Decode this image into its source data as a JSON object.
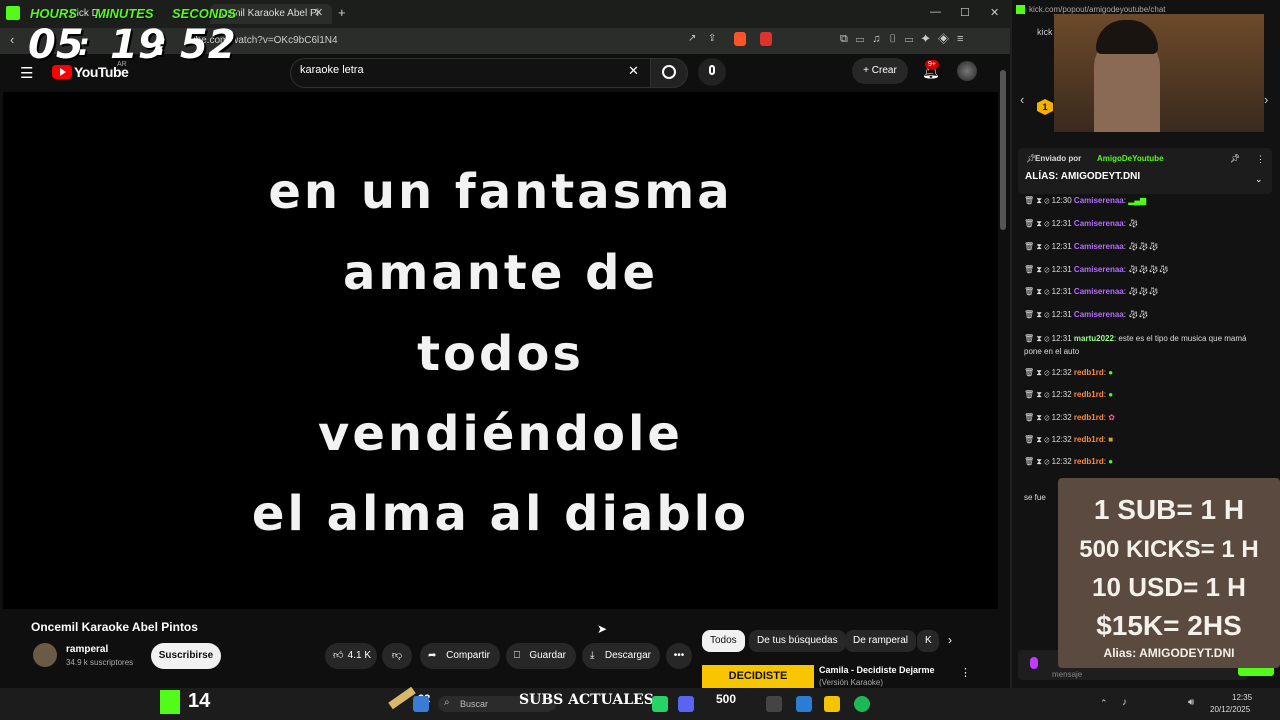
{
  "timer": {
    "labels": [
      "HOURS",
      "MINUTES",
      "SECONDS"
    ],
    "hours": "05",
    "minutes": "19",
    "seconds": "52",
    "sep": ":"
  },
  "browser": {
    "tabs": [
      {
        "label": "Kick D..."
      },
      {
        "label": "ncemil Karaoke Abel Pi"
      }
    ],
    "address": "ube.com/watch?v=OKc9bC6l1N4"
  },
  "youtube": {
    "logo": "YouTube",
    "region": "AR",
    "search_value": "karaoke letra",
    "create_label": "Crear",
    "notif_badge": "9+"
  },
  "video": {
    "lyrics": [
      "en un fantasma",
      "amante de",
      "todos",
      "vendiéndole",
      "el alma al diablo"
    ],
    "title": "Oncemil Karaoke Abel Pintos",
    "channel": "ramperal",
    "subs": "34.9 k suscriptores",
    "subscribe": "Suscribirse",
    "likes": "4.1 K",
    "share": "Compartir",
    "save": "Guardar",
    "download": "Descargar"
  },
  "chips": [
    "Todos",
    "De tus búsquedas",
    "De ramperal",
    "K"
  ],
  "recommended": {
    "thumb_text": "DECIDISTE DEJARME",
    "title": "Camila - Decidiste Dejarme",
    "subtitle": "(Versión Karaoke)"
  },
  "chat": {
    "url": "kick.com/popout/amigodeyoutube/chat",
    "short": "kick",
    "badge": "1",
    "pinned_by": "Enviado por",
    "pinned_user": "AmigoDeYoutube",
    "pinned_text": "ALÍAS: AMIGODEYT.DNI",
    "messages": [
      {
        "time": "12:30",
        "user": "Camiserenaa",
        "text": ":"
      },
      {
        "time": "12:31",
        "user": "Camiserenaa",
        "text": ":"
      },
      {
        "time": "12:31",
        "user": "Camiserenaa",
        "text": ":"
      },
      {
        "time": "12:31",
        "user": "Camiserenaa",
        "text": ":"
      },
      {
        "time": "12:31",
        "user": "Camiserenaa",
        "text": ":"
      },
      {
        "time": "12:31",
        "user": "Camiserenaa",
        "text": ":"
      },
      {
        "time": "12:31",
        "user": "martu2022",
        "text": ": este es el tipo de musica que mamá pone en el auto"
      },
      {
        "time": "12:32",
        "user": "redb1rd",
        "text": ":"
      },
      {
        "time": "12:32",
        "user": "redb1rd",
        "text": ":"
      },
      {
        "time": "12:32",
        "user": "redb1rd",
        "text": ":"
      },
      {
        "time": "12:32",
        "user": "redb1rd",
        "text": ":"
      },
      {
        "time": "12:32",
        "user": "redb1rd",
        "text": ":"
      }
    ],
    "fragment": "se fue",
    "input_placeholder": "mensaje",
    "colors": {
      "camiserenaa": "#b46cff",
      "martu": "#9cff8a",
      "redbird": "#ff8a3c",
      "kick": "#53fc18"
    }
  },
  "sign": {
    "lines": [
      "1 SUB= 1 H",
      "500 KICKS= 1 H",
      "10 USD= 1 H",
      "$15K= 2HS"
    ],
    "alias": "Alias: AMIGODEYT.DNI"
  },
  "overlay_bottom": {
    "kick_count": "14",
    "pencil_num": "22",
    "subs_label": "SUBS ACTUALES",
    "kicks_num": "500"
  },
  "taskbar": {
    "search": "Buscar",
    "time": "12:35",
    "date": "20/12/2025"
  }
}
